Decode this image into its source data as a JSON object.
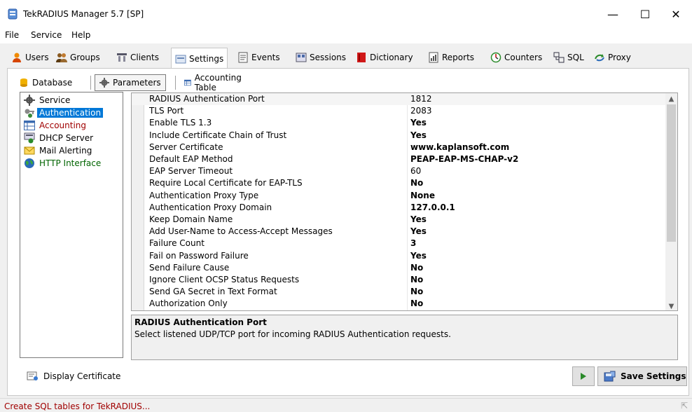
{
  "window": {
    "title": "TekRADIUS Manager 5.7 [SP]",
    "minimize": "—",
    "maximize": "☐",
    "close": "✕"
  },
  "menu": [
    "File",
    "Service",
    "Help"
  ],
  "tabs": [
    {
      "label": "Users",
      "icon": "user-icon"
    },
    {
      "label": "Groups",
      "icon": "groups-icon"
    },
    {
      "label": "Clients",
      "icon": "clients-icon"
    },
    {
      "label": "Settings",
      "icon": "settings-icon",
      "active": true
    },
    {
      "label": "Events",
      "icon": "events-icon"
    },
    {
      "label": "Sessions",
      "icon": "sessions-icon"
    },
    {
      "label": "Dictionary",
      "icon": "dictionary-icon"
    },
    {
      "label": "Reports",
      "icon": "reports-icon"
    },
    {
      "label": "Counters",
      "icon": "counters-icon"
    },
    {
      "label": "SQL",
      "icon": "sql-icon"
    },
    {
      "label": "Proxy",
      "icon": "proxy-icon"
    }
  ],
  "subtabs": [
    {
      "label": "Database",
      "icon": "database-icon"
    },
    {
      "label": "Parameters",
      "icon": "gear-icon",
      "active": true
    },
    {
      "label": "Accounting Table",
      "icon": "table-icon"
    }
  ],
  "tree": [
    {
      "label": "Service",
      "icon": "gear-icon",
      "color": "#000000"
    },
    {
      "label": "Authentication",
      "icon": "key-icon",
      "color": "#ffffff",
      "selected": true
    },
    {
      "label": "Accounting",
      "icon": "table-icon",
      "color": "#a00000"
    },
    {
      "label": "DHCP Server",
      "icon": "dhcp-icon",
      "color": "#000000"
    },
    {
      "label": "Mail Alerting",
      "icon": "mail-icon",
      "color": "#000000"
    },
    {
      "label": "HTTP Interface",
      "icon": "globe-icon",
      "color": "#006400"
    }
  ],
  "params": [
    {
      "name": "RADIUS Authentication Port",
      "value": "1812",
      "bold": false
    },
    {
      "name": "TLS Port",
      "value": "2083",
      "bold": false
    },
    {
      "name": "Enable TLS 1.3",
      "value": "Yes",
      "bold": true
    },
    {
      "name": "Include Certificate Chain of Trust",
      "value": "Yes",
      "bold": true
    },
    {
      "name": "Server Certificate",
      "value": "www.kaplansoft.com",
      "bold": true
    },
    {
      "name": "Default EAP Method",
      "value": "PEAP-EAP-MS-CHAP-v2",
      "bold": true
    },
    {
      "name": "EAP Server Timeout",
      "value": "60",
      "bold": false
    },
    {
      "name": "Require Local Certificate for EAP-TLS",
      "value": "No",
      "bold": true
    },
    {
      "name": "Authentication Proxy Type",
      "value": "None",
      "bold": true
    },
    {
      "name": "Authentication Proxy Domain",
      "value": "127.0.0.1",
      "bold": true
    },
    {
      "name": "Keep Domain Name",
      "value": "Yes",
      "bold": true
    },
    {
      "name": "Add User-Name to Access-Accept Messages",
      "value": "Yes",
      "bold": true
    },
    {
      "name": "Failure Count",
      "value": "3",
      "bold": true
    },
    {
      "name": "Fail on Password Failure",
      "value": "Yes",
      "bold": true
    },
    {
      "name": "Send Failure Cause",
      "value": "No",
      "bold": true
    },
    {
      "name": "Ignore Client OCSP Status Requests",
      "value": "No",
      "bold": true
    },
    {
      "name": "Send GA Secret in Text Format",
      "value": "No",
      "bold": true
    },
    {
      "name": "Authorization Only",
      "value": "No",
      "bold": true
    }
  ],
  "description": {
    "title": "RADIUS Authentication Port",
    "text": "Select listened UDP/TCP port for incoming RADIUS Authentication requests."
  },
  "buttons": {
    "display_certificate": "Display Certificate",
    "save_settings": "Save Settings"
  },
  "status": {
    "text": "Create SQL tables for TekRADIUS..."
  }
}
